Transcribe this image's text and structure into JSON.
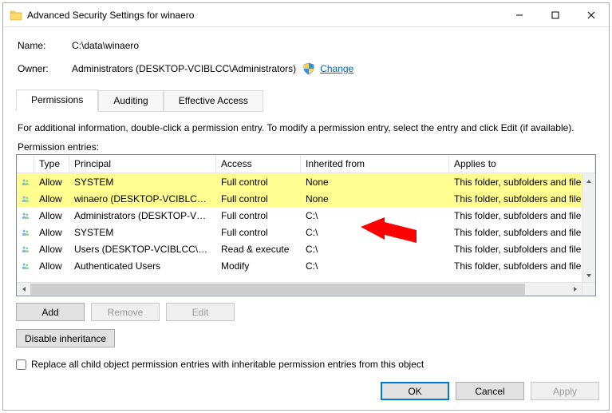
{
  "window": {
    "title": "Advanced Security Settings for winaero"
  },
  "fields": {
    "name_label": "Name:",
    "name_value": "C:\\data\\winaero",
    "owner_label": "Owner:",
    "owner_value": "Administrators (DESKTOP-VCIBLCC\\Administrators)",
    "change_link": "Change"
  },
  "tabs": {
    "permissions": "Permissions",
    "auditing": "Auditing",
    "effective": "Effective Access"
  },
  "info_line": "For additional information, double-click a permission entry. To modify a permission entry, select the entry and click Edit (if available).",
  "entries_label": "Permission entries:",
  "columns": {
    "type": "Type",
    "principal": "Principal",
    "access": "Access",
    "inherited": "Inherited from",
    "applies": "Applies to"
  },
  "rows": [
    {
      "type": "Allow",
      "principal": "SYSTEM",
      "access": "Full control",
      "inherited": "None",
      "applies": "This folder, subfolders and file",
      "highlight": true
    },
    {
      "type": "Allow",
      "principal": "winaero (DESKTOP-VCIBLCC\\...",
      "access": "Full control",
      "inherited": "None",
      "applies": "This folder, subfolders and file",
      "highlight": true
    },
    {
      "type": "Allow",
      "principal": "Administrators (DESKTOP-VCI...",
      "access": "Full control",
      "inherited": "C:\\",
      "applies": "This folder, subfolders and file",
      "highlight": false
    },
    {
      "type": "Allow",
      "principal": "SYSTEM",
      "access": "Full control",
      "inherited": "C:\\",
      "applies": "This folder, subfolders and file",
      "highlight": false
    },
    {
      "type": "Allow",
      "principal": "Users (DESKTOP-VCIBLCC\\Us...",
      "access": "Read & execute",
      "inherited": "C:\\",
      "applies": "This folder, subfolders and file",
      "highlight": false
    },
    {
      "type": "Allow",
      "principal": "Authenticated Users",
      "access": "Modify",
      "inherited": "C:\\",
      "applies": "This folder, subfolders and file",
      "highlight": false
    }
  ],
  "buttons": {
    "add": "Add",
    "remove": "Remove",
    "edit": "Edit",
    "disable_inheritance": "Disable inheritance",
    "ok": "OK",
    "cancel": "Cancel",
    "apply": "Apply"
  },
  "checkbox_label": "Replace all child object permission entries with inheritable permission entries from this object"
}
